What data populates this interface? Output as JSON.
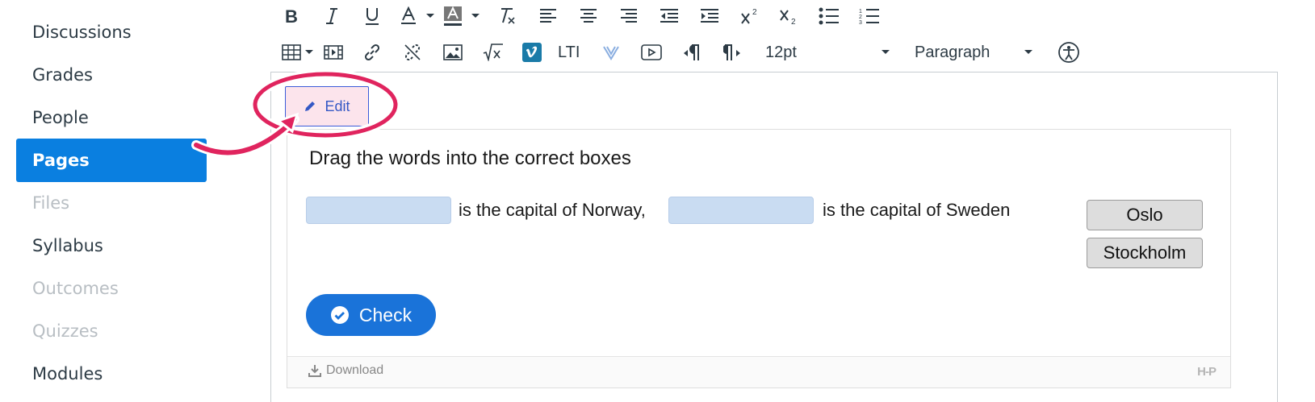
{
  "sidebar": {
    "items": [
      {
        "label": "Discussions",
        "state": "normal"
      },
      {
        "label": "Grades",
        "state": "normal"
      },
      {
        "label": "People",
        "state": "normal"
      },
      {
        "label": "Pages",
        "state": "active"
      },
      {
        "label": "Files",
        "state": "disabled"
      },
      {
        "label": "Syllabus",
        "state": "normal"
      },
      {
        "label": "Outcomes",
        "state": "disabled"
      },
      {
        "label": "Quizzes",
        "state": "disabled"
      },
      {
        "label": "Modules",
        "state": "normal"
      }
    ]
  },
  "toolbar": {
    "row1": [
      "bold-icon",
      "italic-icon",
      "underline-icon",
      "text-color-icon",
      "chevron-down-icon",
      "background-color-icon",
      "chevron-down-icon",
      "clear-formatting-icon",
      "align-left-icon",
      "align-center-icon",
      "align-right-icon",
      "outdent-icon",
      "indent-icon",
      "superscript-icon",
      "subscript-icon",
      "bulleted-list-icon",
      "numbered-list-icon"
    ],
    "row2_icons": [
      "table-icon",
      "media-icon",
      "link-icon",
      "unlink-icon",
      "image-icon",
      "equation-icon",
      "vimeo-icon",
      "lti-icon",
      "vimeo-v-icon",
      "video-icon",
      "ltr-icon",
      "rtl-icon"
    ],
    "lti_label": "LTI",
    "font_size": "12pt",
    "block_format": "Paragraph"
  },
  "h5p": {
    "edit_label": "Edit",
    "task": "Drag the words into the correct boxes",
    "sentence_part1": "is the capital of Norway,",
    "sentence_part2": "is the capital of Sweden",
    "words": [
      "Oslo",
      "Stockholm"
    ],
    "check_label": "Check",
    "download_label": "Download",
    "logo_text": "H-P"
  },
  "colors": {
    "active_nav": "#0a7fe0",
    "check_button": "#1a73d9",
    "drop_zone": "#c9dcf2",
    "annotation": "#e0245e"
  }
}
